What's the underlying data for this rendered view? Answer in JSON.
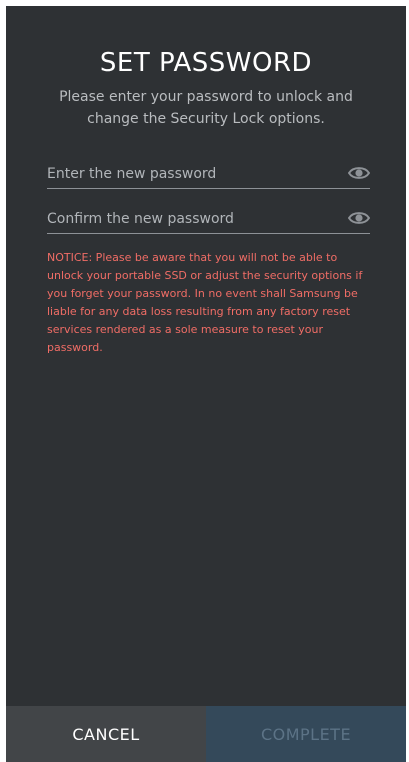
{
  "header": {
    "title": "SET PASSWORD",
    "subtitle": "Please enter your password to unlock and change the Security Lock options."
  },
  "form": {
    "new_password": {
      "value": "",
      "placeholder": "Enter the new password",
      "toggle_icon": "eye-icon"
    },
    "confirm_password": {
      "value": "",
      "placeholder": "Confirm the new password",
      "toggle_icon": "eye-icon"
    }
  },
  "notice": "NOTICE: Please be aware that you will not be able to unlock your portable SSD or adjust the security options if you forget your password. In no event shall Samsung be liable for any data loss resulting from any factory reset services rendered as a sole measure to reset your password.",
  "footer": {
    "cancel_label": "CANCEL",
    "complete_label": "COMPLETE",
    "complete_enabled": false
  },
  "colors": {
    "background": "#2e3134",
    "notice": "#f06d66",
    "cancel_bg": "#424548",
    "complete_bg": "#34495a",
    "complete_text_disabled": "#5c7386"
  }
}
